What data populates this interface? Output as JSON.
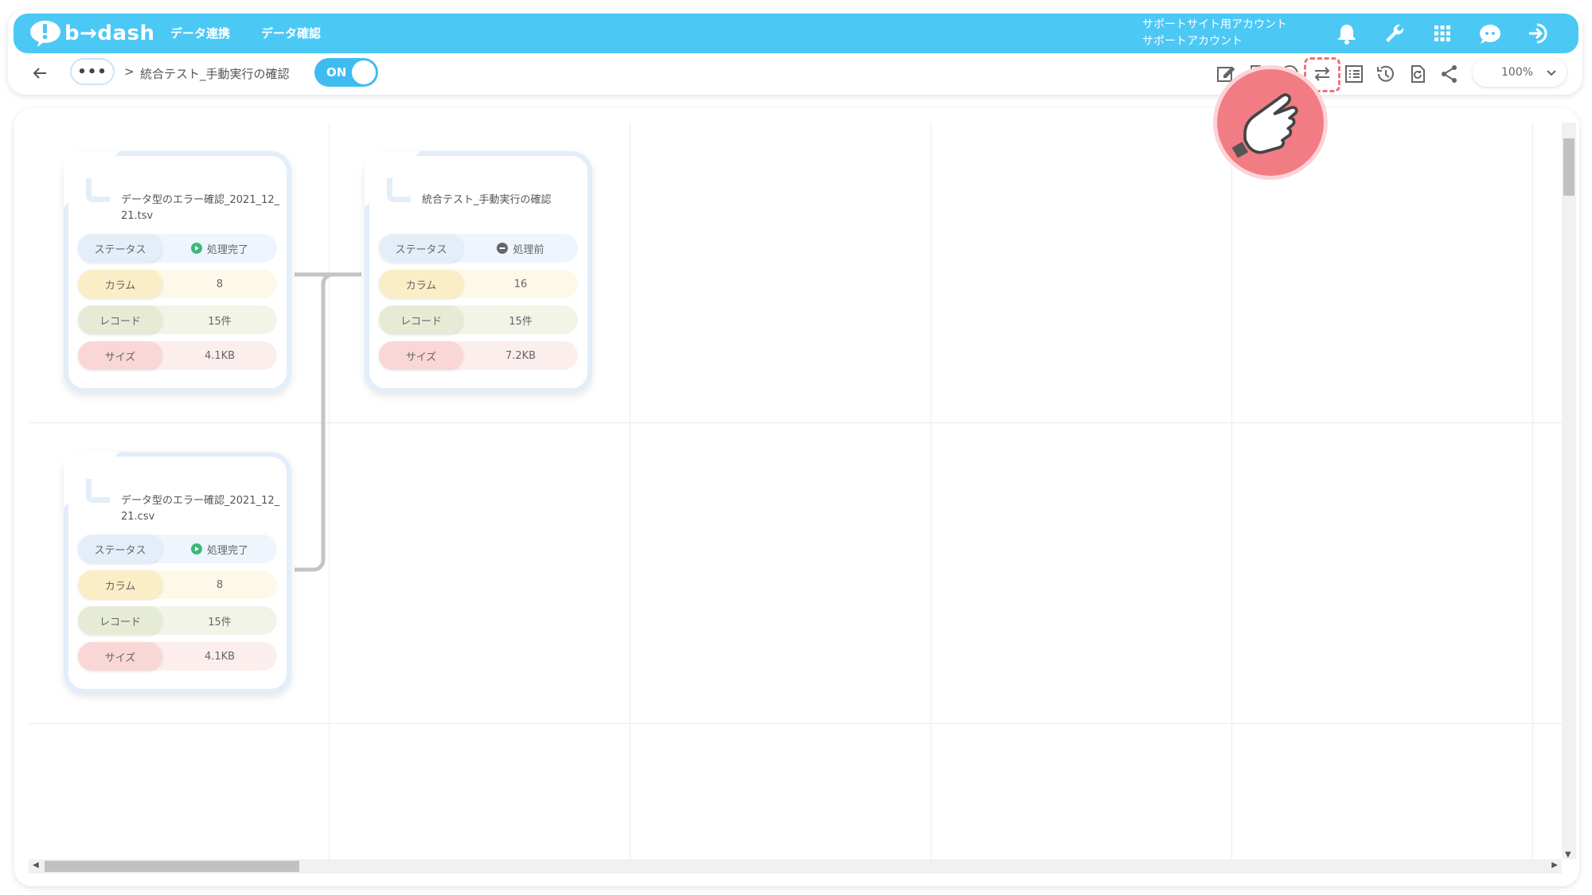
{
  "header": {
    "logo_text": "b→dash",
    "nav": [
      "データ連携",
      "データ確認"
    ],
    "account_line1": "サポートサイト用アカウント",
    "account_line2": "サポートアカウント",
    "icons": [
      "bell-icon",
      "wrench-icon",
      "apps-grid-icon",
      "chat-robot-icon",
      "logout-icon"
    ]
  },
  "subbar": {
    "more_label": "•••",
    "crumb_separator": ">",
    "title": "統合テスト_手動実行の確認",
    "toggle_label": "ON",
    "tools": [
      "edit-icon",
      "copy-icon",
      "run-icon",
      "swap-icon",
      "list-icon",
      "history-icon",
      "refresh-icon",
      "share-icon"
    ],
    "zoom": "100%"
  },
  "cards": [
    {
      "title": "データ型のエラー確認_2021_12_21.tsv",
      "status_label": "ステータス",
      "status_value": "処理完了",
      "status_kind": "done",
      "column_label": "カラム",
      "column_value": "8",
      "record_label": "レコード",
      "record_value": "15件",
      "size_label": "サイズ",
      "size_value": "4.1KB"
    },
    {
      "title": "統合テスト_手動実行の確認",
      "status_label": "ステータス",
      "status_value": "処理前",
      "status_kind": "pending",
      "column_label": "カラム",
      "column_value": "16",
      "record_label": "レコード",
      "record_value": "15件",
      "size_label": "サイズ",
      "size_value": "7.2KB"
    },
    {
      "title": "データ型のエラー確認_2021_12_21.csv",
      "status_label": "ステータス",
      "status_value": "処理完了",
      "status_kind": "done",
      "column_label": "カラム",
      "column_value": "8",
      "record_label": "レコード",
      "record_value": "15件",
      "size_label": "サイズ",
      "size_value": "4.1KB"
    }
  ],
  "colors": {
    "brand": "#4cc8f4",
    "done": "#3cb878",
    "pending": "#666666",
    "pointer": "#f27c84"
  }
}
